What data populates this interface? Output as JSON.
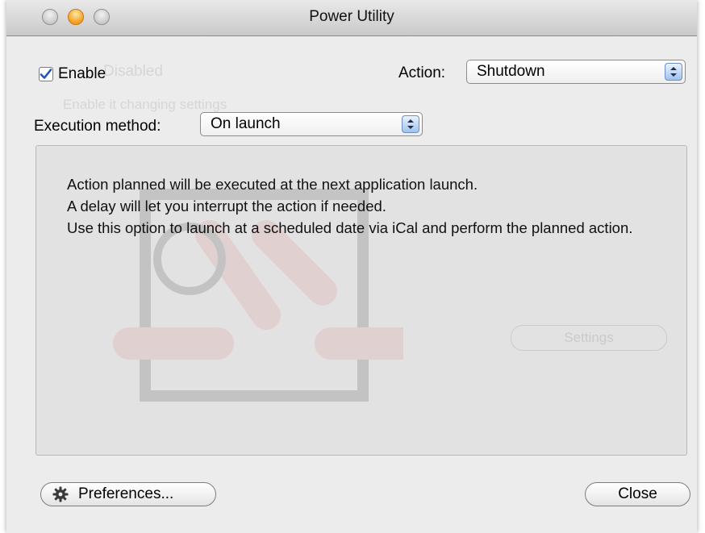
{
  "window": {
    "title": "Power Utility"
  },
  "enable": {
    "label": "Enable",
    "checked": true
  },
  "action": {
    "label": "Action:",
    "selected": "Shutdown"
  },
  "execution": {
    "label": "Execution method:",
    "selected": "On launch"
  },
  "description": {
    "lines": [
      "Action planned will be executed at the next application launch.",
      "A delay will let you interrupt the action if needed.",
      "Use this option to launch at a scheduled date via iCal and perform the planned action."
    ]
  },
  "ghost": {
    "status": "Disabled",
    "option": "Enable it changing settings",
    "settings": "Settings"
  },
  "buttons": {
    "preferences": "Preferences...",
    "close": "Close"
  },
  "icons": {
    "gear": "gear-icon",
    "check": "checkmark-icon",
    "popup_arrows": "up-down-arrows-icon"
  },
  "colors": {
    "window_bg": "#ececec",
    "panel_bg": "#e2e2e2",
    "minimize_light": "#f59b1d",
    "checkmark": "#1f55b3"
  }
}
